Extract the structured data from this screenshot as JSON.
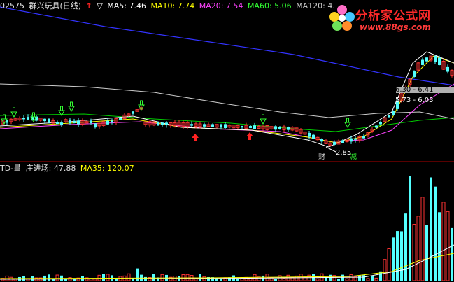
{
  "main_header": {
    "code": "02575",
    "name": "群兴玩具(日线)",
    "arrow_up": "↑",
    "arrow_down": "▽",
    "ma5": "MA5: 7.46",
    "ma10": "MA10: 7.74",
    "ma20": "MA20: 7.54",
    "ma60": "MA60: 5.06",
    "ma120": "MA120: 4."
  },
  "vol_header": {
    "indicator": "TD-量",
    "zhuang": "庄进场: 47.88",
    "ma35": "MA35: 120.07"
  },
  "logo": {
    "title": "分析家公式网",
    "url": "www.88gs.com"
  },
  "annotations": {
    "cai": "财",
    "jian": "减",
    "low_price": "2.85",
    "range_upper": "6.30 - 6.41",
    "range_lower": "5.73 - 6.03"
  },
  "colors": {
    "bull": "#ff3333",
    "bear": "#54ffff",
    "ma5": "#ffffff",
    "ma10": "#ffff00",
    "ma20": "#ff44ff",
    "ma60": "#00cc00",
    "ma120": "#cccccc",
    "long_ma": "#3333ff",
    "signal_down": "#33ff33",
    "signal_up": "#ff2222"
  }
}
